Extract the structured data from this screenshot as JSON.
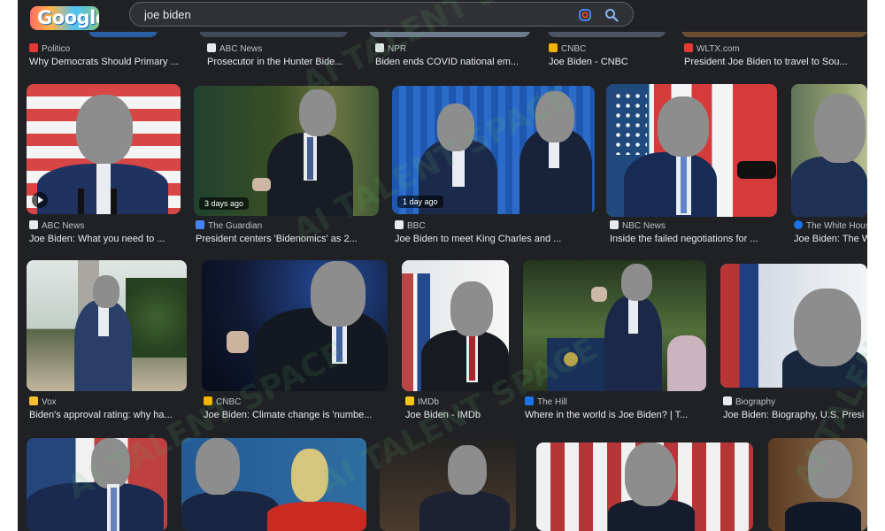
{
  "search": {
    "query": "joe biden"
  },
  "logo_text": "Google",
  "icons": {
    "lens": "google-lens-icon",
    "search": "search-icon"
  },
  "sources": {
    "politico": {
      "name": "Politico",
      "color": "#e53935"
    },
    "abc": {
      "name": "ABC News",
      "color": "#e8eaed"
    },
    "npr": {
      "name": "NPR",
      "color": "#e8eaed"
    },
    "cnbc": {
      "name": "CNBC",
      "color": "#f4b400"
    },
    "wltx": {
      "name": "WLTX.com",
      "color": "#e53935"
    },
    "guardian": {
      "name": "The Guardian",
      "color": "#4285f4"
    },
    "bbc": {
      "name": "BBC",
      "color": "#e8eaed"
    },
    "nbc": {
      "name": "NBC News",
      "color": "#e8eaed"
    },
    "whitehouse": {
      "name": "The White House",
      "color": "#1a73e8"
    },
    "vox": {
      "name": "Vox",
      "color": "#fbc02d"
    },
    "imdb": {
      "name": "IMDb",
      "color": "#f5c518"
    },
    "hill": {
      "name": "The Hill",
      "color": "#1a73e8"
    },
    "biography": {
      "name": "Biography",
      "color": "#e8eaed"
    }
  },
  "top_strip": [
    {
      "source": "Politico",
      "title": "Why Democrats Should Primary ..."
    },
    {
      "source": "ABC News",
      "title": "Prosecutor in the Hunter Bide..."
    },
    {
      "source": "NPR",
      "title": "Biden ends COVID national em..."
    },
    {
      "source": "CNBC",
      "title": "Joe Biden - CNBC"
    },
    {
      "source": "WLTX.com",
      "title": "President Joe Biden to travel to Sou..."
    }
  ],
  "row1": [
    {
      "source": "ABC News",
      "title": "Joe Biden: What you need to ...",
      "badge": ""
    },
    {
      "source": "The Guardian",
      "title": "President centers 'Bidenomics' as 2...",
      "badge": "3 days ago"
    },
    {
      "source": "BBC",
      "title": "Joe Biden to meet King Charles and ...",
      "badge": "1 day ago"
    },
    {
      "source": "NBC News",
      "title": "Inside the failed negotiations for ...",
      "badge": ""
    },
    {
      "source": "The White House",
      "title": "Joe Biden: The W",
      "badge": ""
    }
  ],
  "row2": [
    {
      "source": "Vox",
      "title": "Biden's approval rating: why ha..."
    },
    {
      "source": "CNBC",
      "title": "Joe Biden: Climate change is 'numbe..."
    },
    {
      "source": "IMDb",
      "title": "Joe Biden - IMDb"
    },
    {
      "source": "The Hill",
      "title": "Where in the world is Joe Biden? | T..."
    },
    {
      "source": "Biography",
      "title": "Joe Biden: Biography, U.S. Presi"
    }
  ],
  "watermark": "AI TALENT SPACE"
}
